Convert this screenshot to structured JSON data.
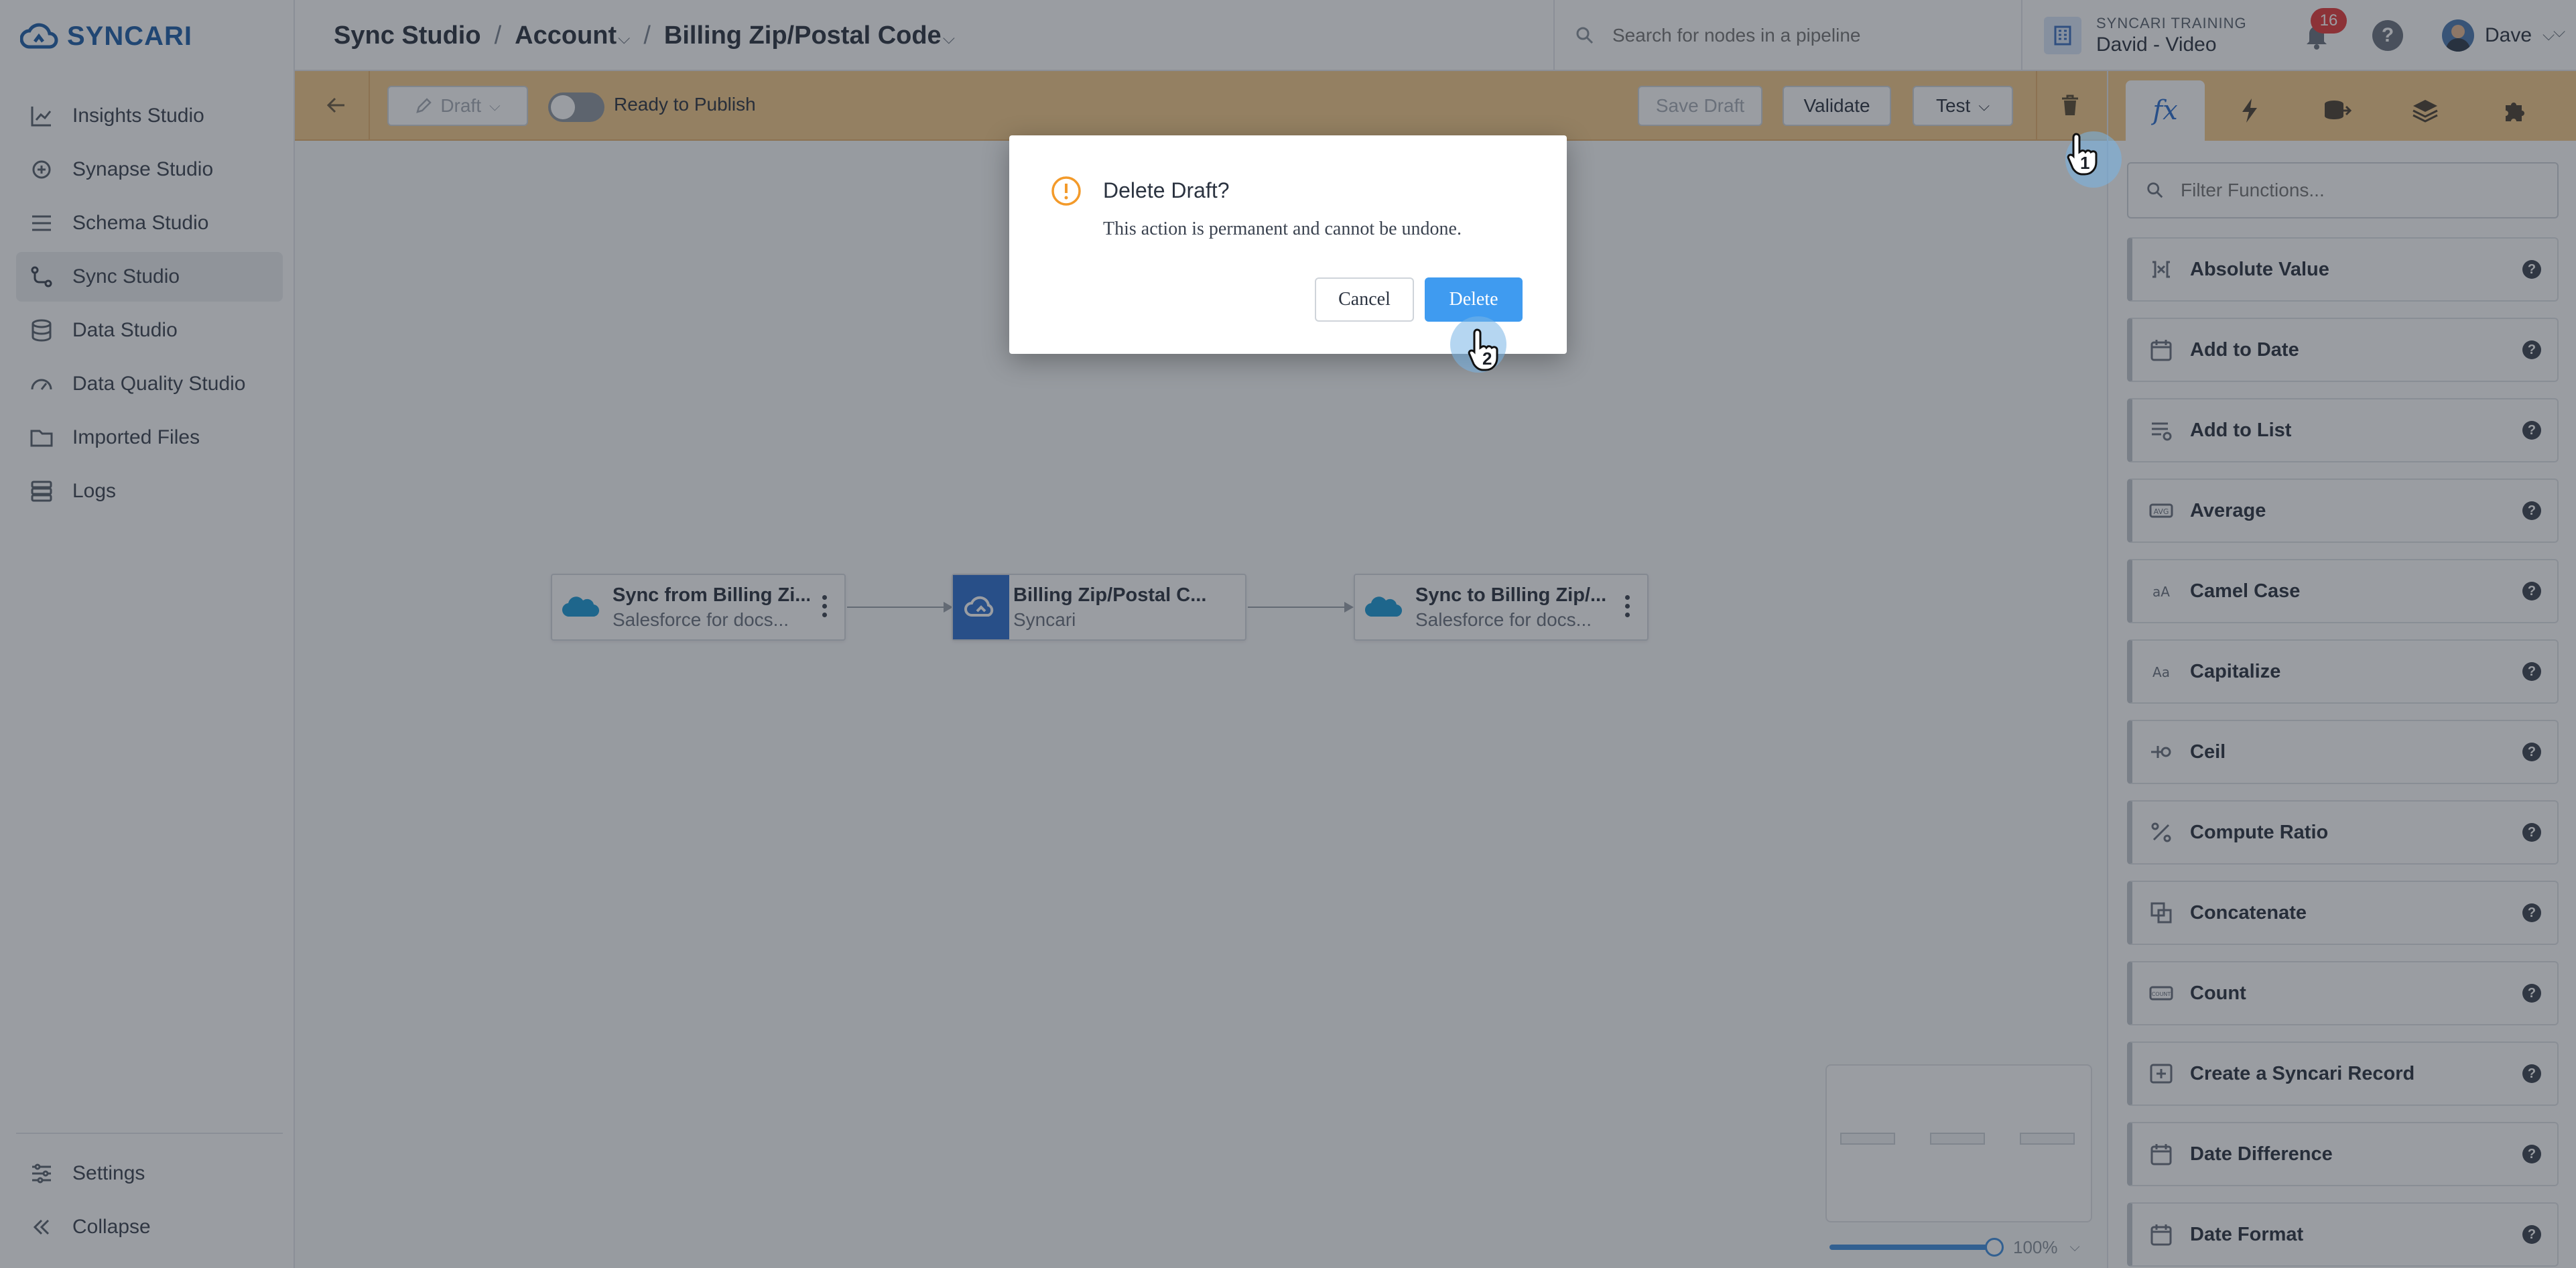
{
  "brand": {
    "name": "SYNCARI",
    "color": "#1f5fa8"
  },
  "sidebar": {
    "items": [
      {
        "label": "Insights Studio",
        "icon": "chart-icon",
        "active": false
      },
      {
        "label": "Synapse Studio",
        "icon": "synapse-icon",
        "active": false
      },
      {
        "label": "Schema Studio",
        "icon": "schema-icon",
        "active": false
      },
      {
        "label": "Sync Studio",
        "icon": "sync-icon",
        "active": true
      },
      {
        "label": "Data Studio",
        "icon": "database-icon",
        "active": false
      },
      {
        "label": "Data Quality Studio",
        "icon": "gauge-icon",
        "active": false
      },
      {
        "label": "Imported Files",
        "icon": "folder-icon",
        "active": false
      },
      {
        "label": "Logs",
        "icon": "logs-icon",
        "active": false
      }
    ],
    "footer": {
      "settings": "Settings",
      "collapse": "Collapse"
    }
  },
  "header": {
    "breadcrumb": [
      "Sync Studio",
      "Account",
      "Billing Zip/Postal Code"
    ],
    "search_placeholder": "Search for nodes in a pipeline",
    "org_label": "SYNCARI TRAINING",
    "org_name": "David - Video",
    "notification_count": "16",
    "user_name": "Dave"
  },
  "toolbar": {
    "draft_label": "Draft",
    "ready_label": "Ready to Publish",
    "save_draft": "Save Draft",
    "validate": "Validate",
    "test": "Test",
    "accent": "#f4c98a"
  },
  "pipeline": {
    "nodes": [
      {
        "title": "Sync from Billing Zi...",
        "subtitle": "Salesforce for docs...",
        "kind": "salesforce"
      },
      {
        "title": "Billing Zip/Postal C...",
        "subtitle": "Syncari",
        "kind": "syncari"
      },
      {
        "title": "Sync to Billing Zip/...",
        "subtitle": "Salesforce for docs...",
        "kind": "salesforce"
      }
    ],
    "zoom": "100%"
  },
  "right_panel": {
    "tabs": [
      "fx",
      "bolt",
      "source-db",
      "layers",
      "puzzle"
    ],
    "filter_placeholder": "Filter Functions...",
    "functions": [
      {
        "label": "Absolute Value",
        "icon": "absolute-icon"
      },
      {
        "label": "Add to Date",
        "icon": "calendar-icon"
      },
      {
        "label": "Add to List",
        "icon": "list-icon"
      },
      {
        "label": "Average",
        "icon": "average-icon"
      },
      {
        "label": "Camel Case",
        "icon": "camelcase-icon"
      },
      {
        "label": "Capitalize",
        "icon": "capitalize-icon"
      },
      {
        "label": "Ceil",
        "icon": "ceil-icon"
      },
      {
        "label": "Compute Ratio",
        "icon": "percent-icon"
      },
      {
        "label": "Concatenate",
        "icon": "concatenate-icon"
      },
      {
        "label": "Count",
        "icon": "count-icon"
      },
      {
        "label": "Create a Syncari Record",
        "icon": "record-icon"
      },
      {
        "label": "Date Difference",
        "icon": "calendar-icon"
      },
      {
        "label": "Date Format",
        "icon": "calendar-icon"
      }
    ]
  },
  "dialog": {
    "title": "Delete Draft?",
    "body": "This action is permanent and cannot be undone.",
    "cancel": "Cancel",
    "delete": "Delete",
    "warn_color": "#f39a2a",
    "primary_color": "#3f9bf0"
  },
  "annotations": {
    "step1": "1",
    "step2": "2"
  }
}
